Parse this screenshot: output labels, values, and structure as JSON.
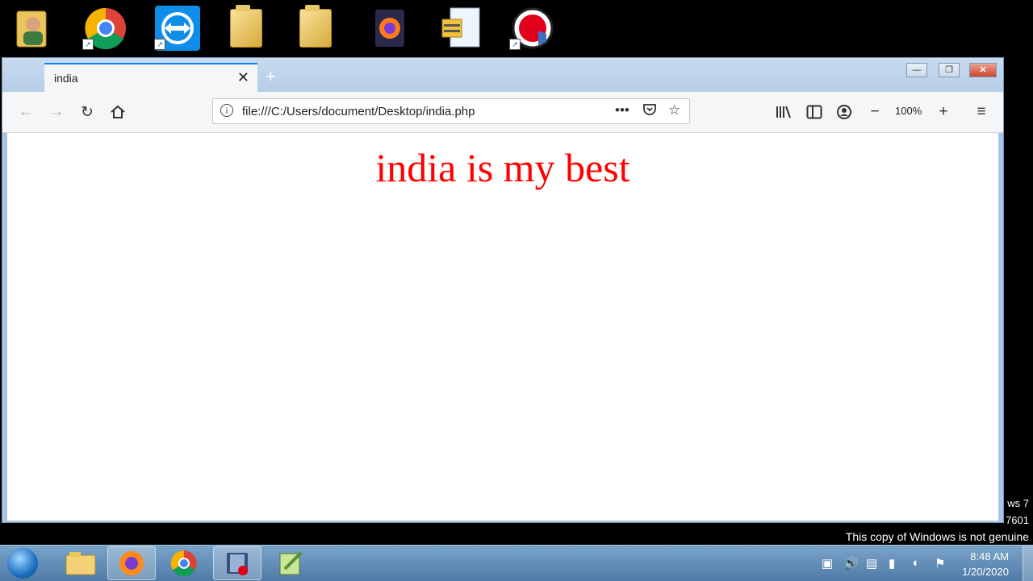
{
  "desktop": {
    "icons": [
      {
        "name": "user-folder-icon"
      },
      {
        "name": "chrome-shortcut-icon"
      },
      {
        "name": "teamviewer-shortcut-icon"
      },
      {
        "name": "folder-icon"
      },
      {
        "name": "zip-folder-icon"
      },
      {
        "name": "firefox-installer-icon"
      },
      {
        "name": "archive-file-icon"
      },
      {
        "name": "screen-recorder-shortcut-icon"
      }
    ]
  },
  "browser": {
    "tab_title": "india",
    "tab_close_glyph": "✕",
    "new_tab_glyph": "+",
    "url": "file:///C:/Users/document/Desktop/india.php",
    "zoom_level": "100%",
    "nav_icons": [
      "back-arrow-icon",
      "forward-arrow-icon",
      "reload-icon",
      "home-icon"
    ],
    "toolbar_icons": [
      "library-icon",
      "sidebar-icon",
      "account-icon",
      "zoom-out-icon",
      "zoom-in-icon",
      "menu-icon"
    ],
    "window_controls": {
      "minimize": "—",
      "restore": "❐",
      "close": "✕"
    }
  },
  "page": {
    "headline": "india is my best",
    "headline_color": "#ff0000"
  },
  "watermark": {
    "line1": "ws 7",
    "line2": "7601",
    "notice": "This copy of Windows is not genuine"
  },
  "taskbar": {
    "pinned": [
      "explorer",
      "firefox",
      "chrome",
      "media-recorder",
      "notepad-plus-plus"
    ],
    "clock_time": "8:48 AM",
    "clock_date": "1/20/2020"
  }
}
